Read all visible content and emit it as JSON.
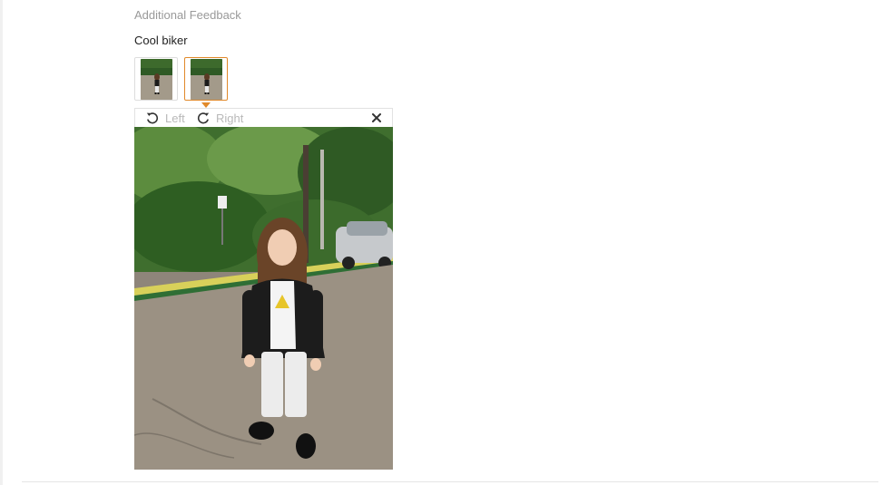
{
  "section": {
    "title": "Additional Feedback"
  },
  "feedback": {
    "text": "Cool biker"
  },
  "thumbnails": [
    {
      "label": "",
      "selected": false
    },
    {
      "label": "",
      "selected": true
    }
  ],
  "viewer": {
    "rotate_left_label": "Left",
    "rotate_right_label": "Right",
    "close_icon": "close-icon"
  },
  "colors": {
    "accent": "#e1892a",
    "muted_text": "#999999",
    "disabled_text": "#b9b9b9"
  }
}
